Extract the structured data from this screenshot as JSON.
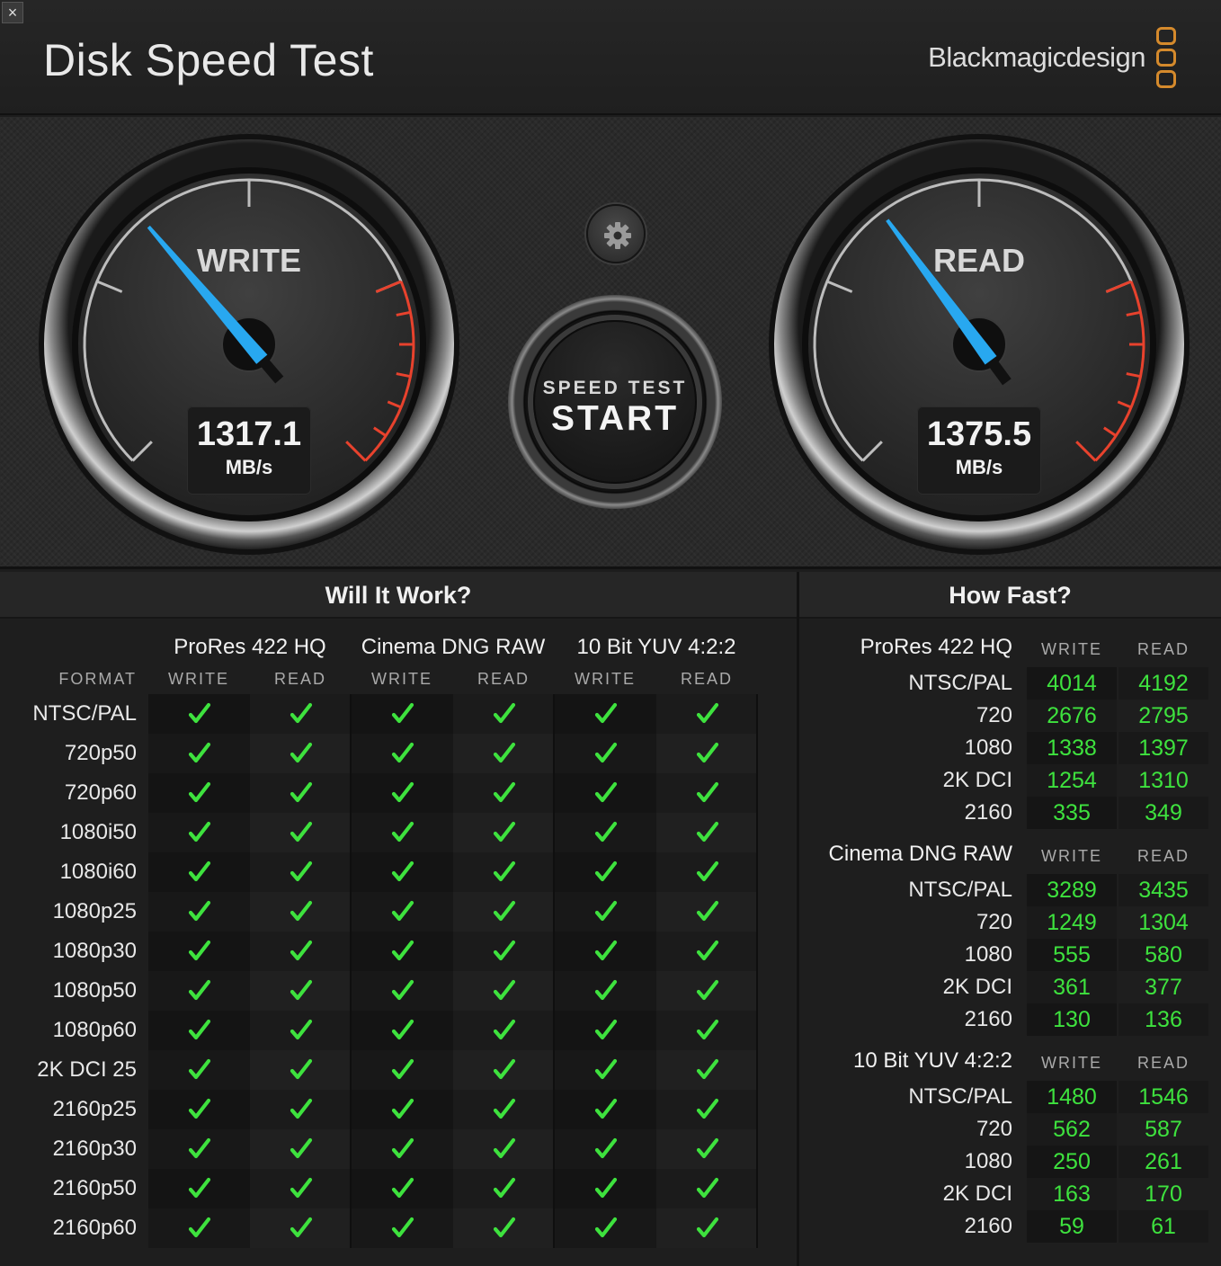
{
  "window": {
    "title": "Disk Speed Test",
    "brand": "Blackmagicdesign",
    "close_icon": "×"
  },
  "gauges": {
    "write": {
      "label": "WRITE",
      "value": "1317.1",
      "unit": "MB/s",
      "needle_fraction": 0.35
    },
    "read": {
      "label": "READ",
      "value": "1375.5",
      "unit": "MB/s",
      "needle_fraction": 0.365
    },
    "needle_color": "#28a8f0",
    "redline_color": "#e8422d"
  },
  "start_button": {
    "small": "SPEED TEST",
    "big": "START"
  },
  "will_it_work": {
    "title": "Will It Work?",
    "format_label": "FORMAT",
    "groups": [
      "ProRes 422 HQ",
      "Cinema DNG RAW",
      "10 Bit YUV 4:2:2"
    ],
    "columns": [
      "WRITE",
      "READ",
      "WRITE",
      "READ",
      "WRITE",
      "READ"
    ],
    "rows": [
      "NTSC/PAL",
      "720p50",
      "720p60",
      "1080i50",
      "1080i60",
      "1080p25",
      "1080p30",
      "1080p50",
      "1080p60",
      "2K DCI 25",
      "2160p25",
      "2160p30",
      "2160p50",
      "2160p60"
    ],
    "check_color": "#3ee23e"
  },
  "how_fast": {
    "title": "How Fast?",
    "write_label": "WRITE",
    "read_label": "READ",
    "sections": [
      {
        "title": "ProRes 422 HQ",
        "rows": [
          {
            "label": "NTSC/PAL",
            "write": "4014",
            "read": "4192"
          },
          {
            "label": "720",
            "write": "2676",
            "read": "2795"
          },
          {
            "label": "1080",
            "write": "1338",
            "read": "1397"
          },
          {
            "label": "2K DCI",
            "write": "1254",
            "read": "1310"
          },
          {
            "label": "2160",
            "write": "335",
            "read": "349"
          }
        ]
      },
      {
        "title": "Cinema DNG RAW",
        "rows": [
          {
            "label": "NTSC/PAL",
            "write": "3289",
            "read": "3435"
          },
          {
            "label": "720",
            "write": "1249",
            "read": "1304"
          },
          {
            "label": "1080",
            "write": "555",
            "read": "580"
          },
          {
            "label": "2K DCI",
            "write": "361",
            "read": "377"
          },
          {
            "label": "2160",
            "write": "130",
            "read": "136"
          }
        ]
      },
      {
        "title": "10 Bit YUV 4:2:2",
        "rows": [
          {
            "label": "NTSC/PAL",
            "write": "1480",
            "read": "1546"
          },
          {
            "label": "720",
            "write": "562",
            "read": "587"
          },
          {
            "label": "1080",
            "write": "250",
            "read": "261"
          },
          {
            "label": "2K DCI",
            "write": "163",
            "read": "170"
          },
          {
            "label": "2160",
            "write": "59",
            "read": "61"
          }
        ]
      }
    ]
  }
}
